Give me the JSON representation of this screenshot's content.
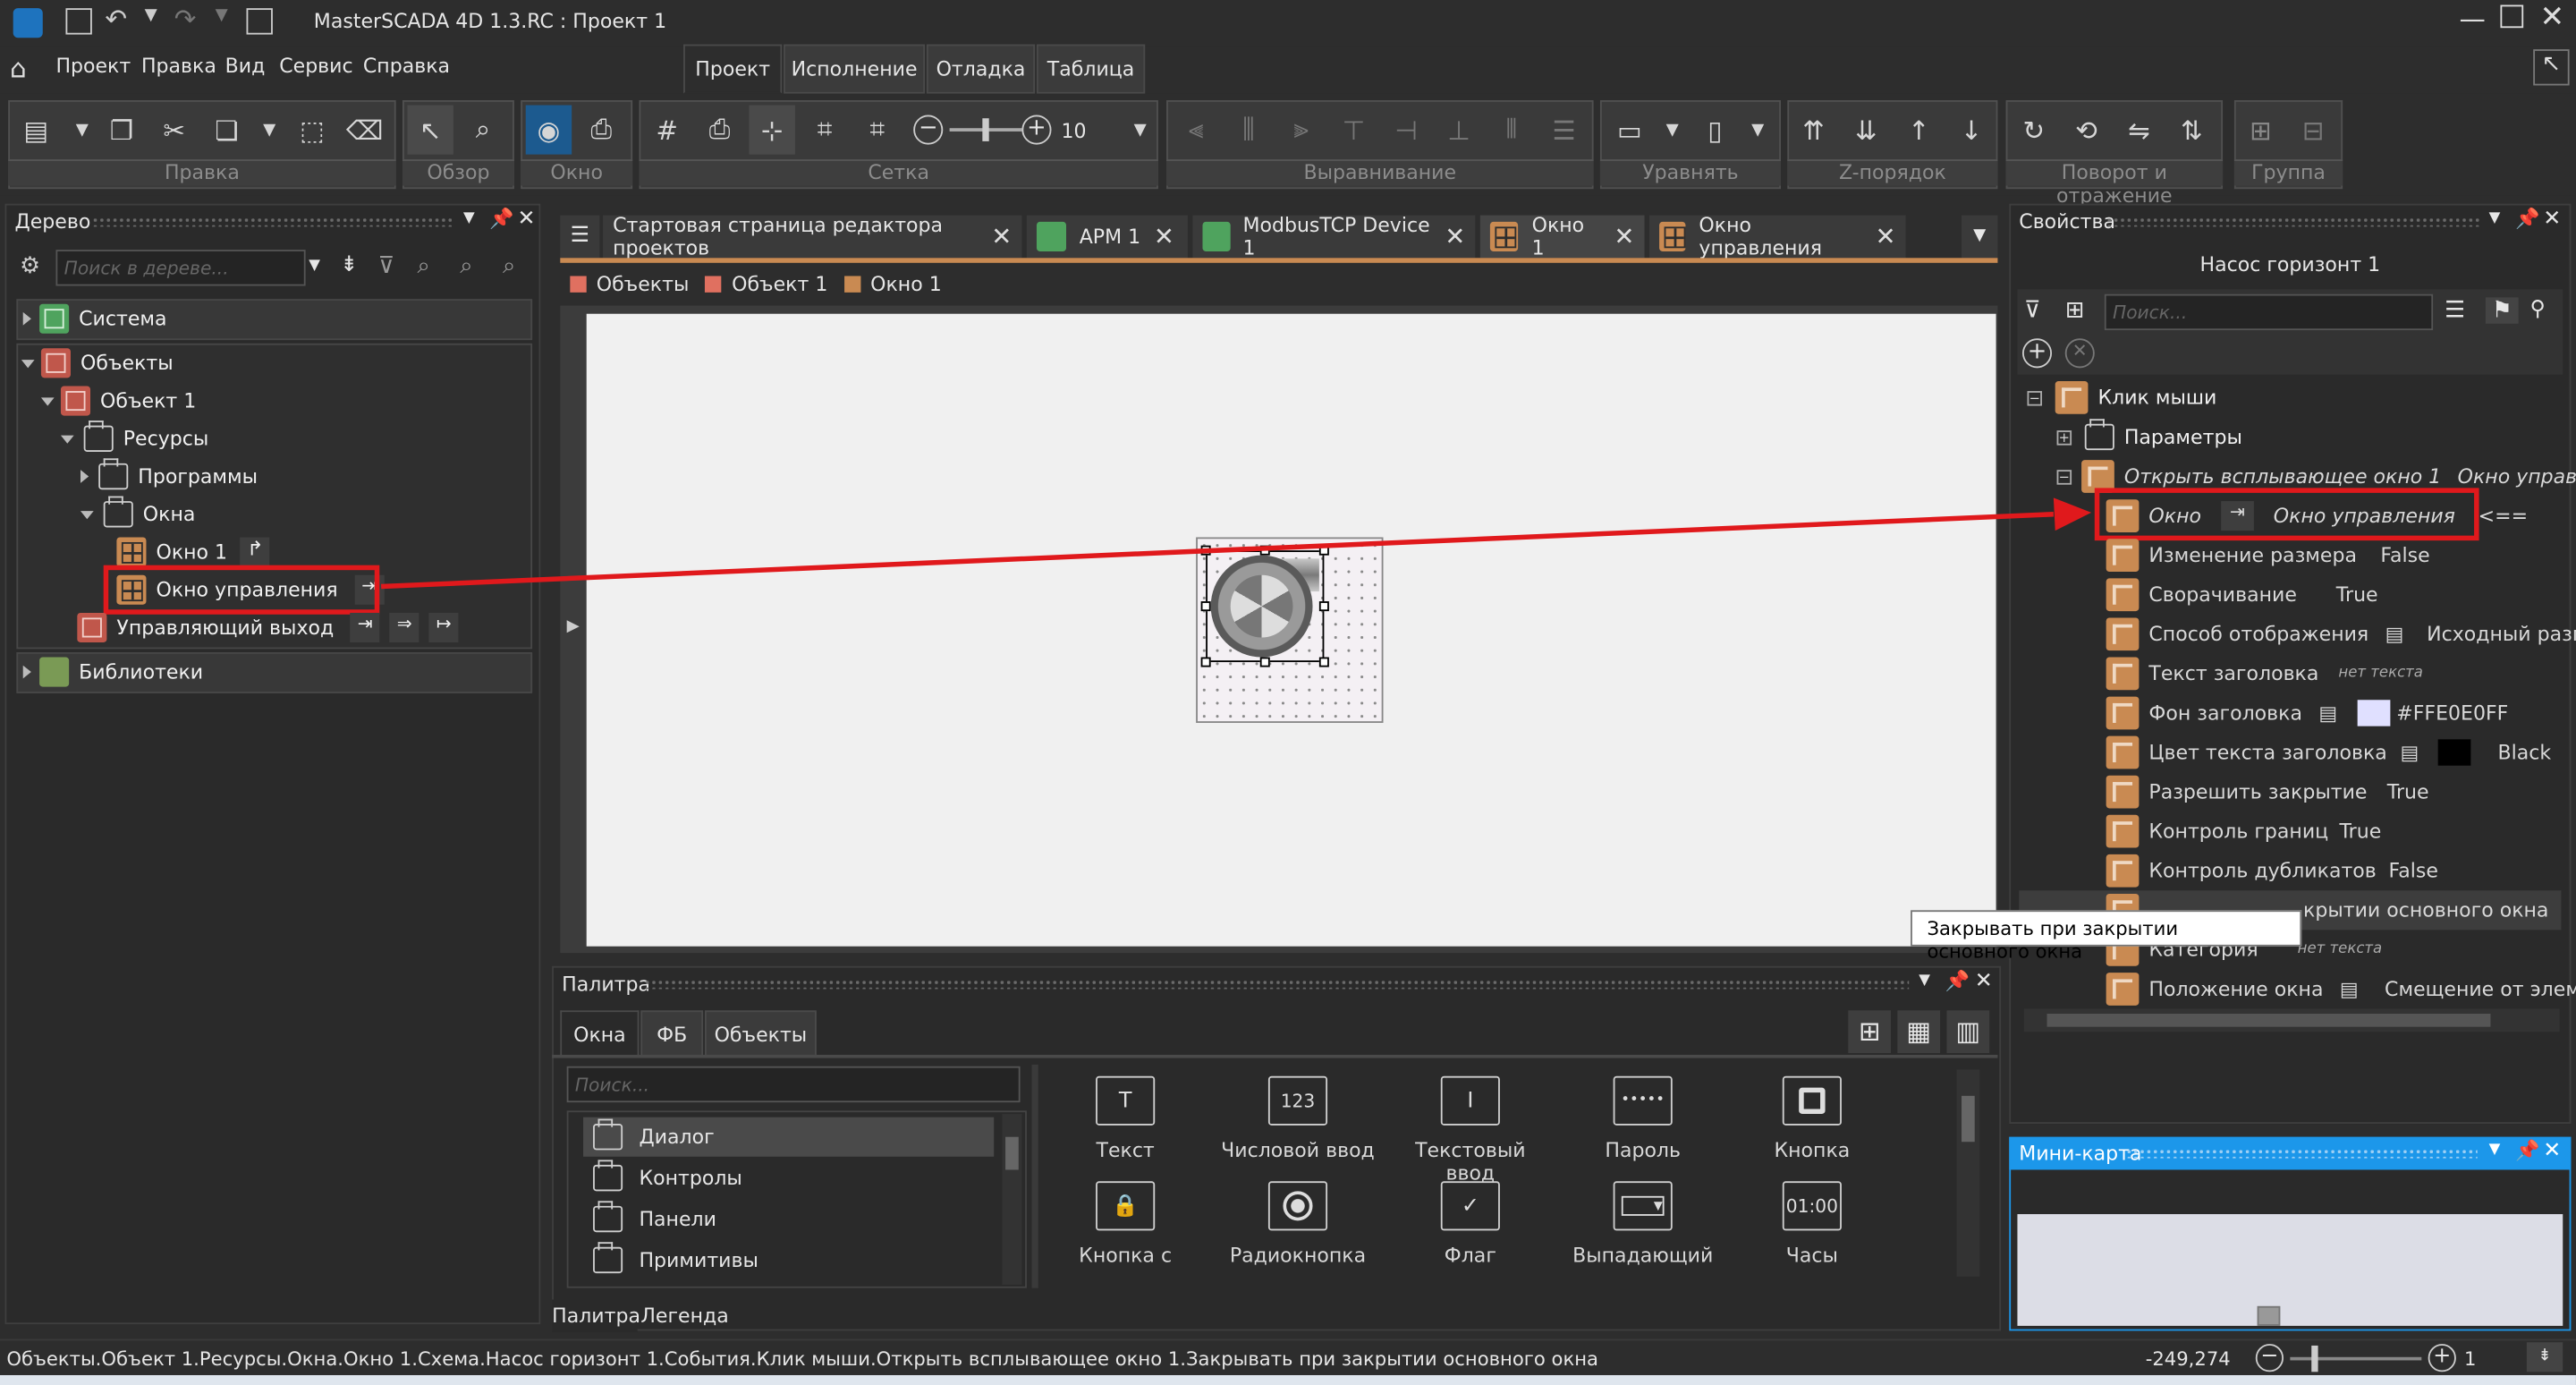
{
  "app": {
    "title": "MasterSCADA 4D 1.3.RC :  Проект 1"
  },
  "menu": [
    "Проект",
    "Правка",
    "Вид",
    "Сервис",
    "Справка"
  ],
  "ribbon_tabs": [
    "Проект",
    "Исполнение",
    "Отладка",
    "Таблица"
  ],
  "toolbar_groups": [
    "Правка",
    "Обзор",
    "Окно",
    "Сетка",
    "Выравнивание",
    "Уравнять",
    "Z-порядок",
    "Поворот и отражение",
    "Группа"
  ],
  "grid_value": "10",
  "tree": {
    "title": "Дерево",
    "search_placeholder": "Поиск в дереве...",
    "items": [
      "Система",
      "Объекты",
      "Объект 1",
      "Ресурсы",
      "Программы",
      "Окна",
      "Окно 1",
      "Окно управления",
      "Управляющий выход",
      "Библиотеки"
    ]
  },
  "doc_tabs": [
    "Стартовая страница редактора проектов",
    "АРМ 1",
    "ModbusTCP Device 1",
    "Окно 1",
    "Окно управления"
  ],
  "breadcrumb": [
    "Объекты",
    "Объект 1",
    "Окно 1"
  ],
  "properties": {
    "title": "Свойства",
    "object": "Насос горизонт 1",
    "search_placeholder": "Поиск...",
    "event": "Клик мыши",
    "params": "Параметры",
    "action": "Открыть всплывающее окно 1",
    "action_value": "Окно управления",
    "rows": [
      {
        "name": "Окно",
        "value": "Окно управления",
        "extra": "<=="
      },
      {
        "name": "Изменение размера",
        "value": "False"
      },
      {
        "name": "Сворачивание",
        "value": "True"
      },
      {
        "name": "Способ отображения",
        "value": "Исходный размер"
      },
      {
        "name": "Текст заголовка",
        "value": "нет текста"
      },
      {
        "name": "Фон заголовка",
        "value": "#FFE0E0FF"
      },
      {
        "name": "Цвет текста заголовка",
        "value": "Black"
      },
      {
        "name": "Разрешить закрытие",
        "value": "True"
      },
      {
        "name": "Контроль границ",
        "value": "True"
      },
      {
        "name": "Контроль дубликатов",
        "value": "False"
      },
      {
        "name": "Закрывать при закрытии основного окна",
        "value": ""
      },
      {
        "name": "Категория",
        "value": "нет текста"
      },
      {
        "name": "Положение окна",
        "value": "Смещение от элемента"
      }
    ],
    "tooltip": "Закрывать при закрытии основного окна",
    "row10_visible": "крытии основного окна"
  },
  "palette": {
    "title": "Палитра",
    "tabs": [
      "Окна",
      "ФБ",
      "Объекты"
    ],
    "search_placeholder": "Поиск...",
    "categories": [
      "Диалог",
      "Контролы",
      "Панели",
      "Примитивы"
    ],
    "items": [
      "Текст",
      "Числовой ввод",
      "Текстовый ввод",
      "Пароль",
      "Кнопка",
      "Кнопка с",
      "Радиокнопка",
      "Флаг",
      "Выпадающий",
      "Часы"
    ],
    "glyphs": [
      "T",
      "123",
      "I",
      "•••••",
      "",
      "",
      "",
      "✓",
      "",
      ""
    ],
    "clock": "01:00",
    "bottom_tabs": [
      "Палитра",
      "Легенда"
    ]
  },
  "minimap": {
    "title": "Мини-карта"
  },
  "status": {
    "path": "Объекты.Объект 1.Ресурсы.Окна.Окно 1.Схема.Насос горизонт 1.События.Клик мыши.Открыть всплывающее окно 1.Закрывать при закрытии основного окна",
    "coords": "-249,274",
    "zoom": "1"
  },
  "colors": {
    "highlight": "#e0191c",
    "accent_blue": "#1c97ea",
    "title_bg_swatch": "#E0E0FF"
  }
}
